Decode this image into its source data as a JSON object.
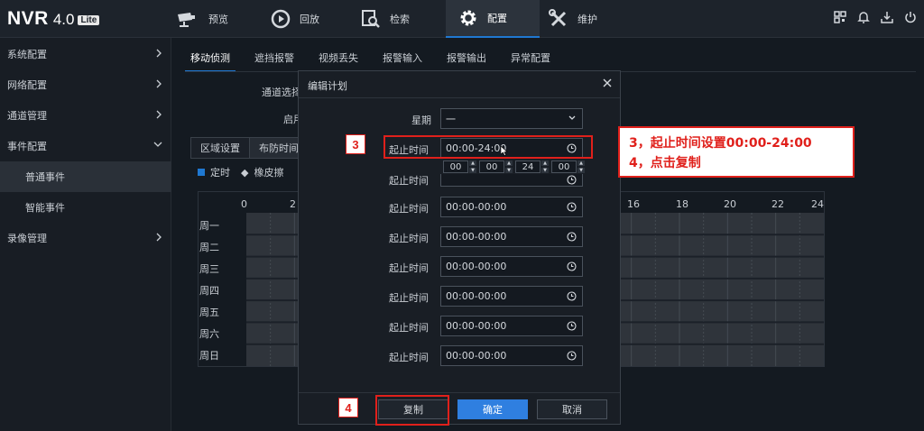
{
  "app": {
    "logo": "NVR",
    "version": "4.0",
    "edition": "Lite"
  },
  "top_nav": [
    {
      "label": "预览",
      "icon": "camera-icon",
      "active": false
    },
    {
      "label": "回放",
      "icon": "playback-icon",
      "active": false
    },
    {
      "label": "检索",
      "icon": "search-file-icon",
      "active": false
    },
    {
      "label": "配置",
      "icon": "gear-icon",
      "active": true
    },
    {
      "label": "维护",
      "icon": "wrench-icon",
      "active": false
    }
  ],
  "top_icons": [
    "qr-code-icon",
    "bell-icon",
    "download-icon",
    "power-icon"
  ],
  "sidebar": {
    "items": [
      {
        "label": "系统配置",
        "expanded": false
      },
      {
        "label": "网络配置",
        "expanded": false
      },
      {
        "label": "通道管理",
        "expanded": false
      },
      {
        "label": "事件配置",
        "expanded": true
      },
      {
        "label": "普通事件",
        "sub": true,
        "selected": true
      },
      {
        "label": "智能事件",
        "sub": true
      },
      {
        "label": "录像管理",
        "expanded": false
      }
    ]
  },
  "main": {
    "tabs": [
      "移动侦测",
      "遮挡报警",
      "视频丢失",
      "报警输入",
      "报警输出",
      "异常配置"
    ],
    "active_tab": "移动侦测",
    "channel_label": "通道选择",
    "enable_label": "启用",
    "subtabs": [
      "区域设置",
      "布防时间"
    ],
    "legend_timed": "定时",
    "legend_eraser": "橡皮擦",
    "hours": [
      "0",
      "2",
      "16",
      "18",
      "20",
      "22",
      "24"
    ],
    "days": [
      "周一",
      "周二",
      "周三",
      "周四",
      "周五",
      "周六",
      "周日"
    ]
  },
  "modal": {
    "title": "编辑计划",
    "week_label": "星期",
    "week_value": "一",
    "time_label": "起止时间",
    "periods": [
      "00:00-24:00",
      "00:00-00:00",
      "00:00-00:00",
      "00:00-00:00",
      "00:00-00:00",
      "00:00-00:00",
      "00:00-00:00",
      "00:00-00:00"
    ],
    "spinner": [
      "00",
      "00",
      "24",
      "00"
    ],
    "buttons": {
      "copy": "复制",
      "confirm": "确定",
      "cancel": "取消"
    }
  },
  "annotations": {
    "step3": "3",
    "step4": "4",
    "callout_line1": "3，起止时间设置00:00-24:00",
    "callout_line2": "4，点击复制",
    "color": "#e0201b"
  },
  "colors": {
    "accent": "#1f78d1",
    "primary_button": "#2f7fe0"
  }
}
